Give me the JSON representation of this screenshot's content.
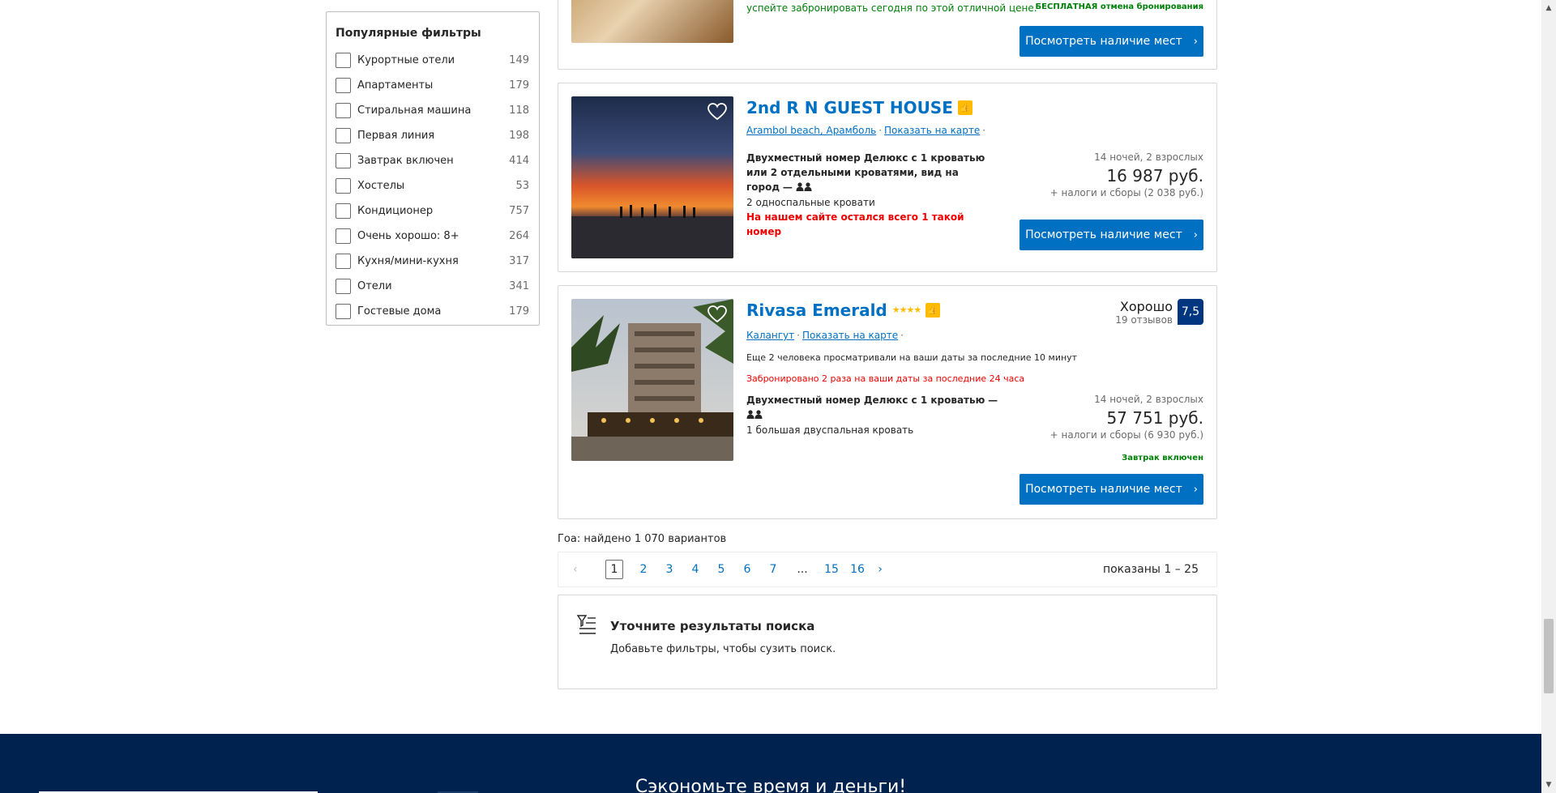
{
  "filters": {
    "title": "Популярные фильтры",
    "items": [
      {
        "label": "Курортные отели",
        "count": "149"
      },
      {
        "label": "Апартаменты",
        "count": "179"
      },
      {
        "label": "Стиральная машина",
        "count": "118"
      },
      {
        "label": "Первая линия",
        "count": "198"
      },
      {
        "label": "Завтрак включен",
        "count": "414"
      },
      {
        "label": "Хостелы",
        "count": "53"
      },
      {
        "label": "Кондиционер",
        "count": "757"
      },
      {
        "label": "Очень хорошо: 8+",
        "count": "264"
      },
      {
        "label": "Кухня/мини-кухня",
        "count": "317"
      },
      {
        "label": "Отели",
        "count": "341"
      },
      {
        "label": "Гостевые дома",
        "count": "179"
      }
    ]
  },
  "cards": {
    "top": {
      "promo": "успейте забронировать сегодня по этой отличной цене.",
      "free_cancel": "БЕСПЛАТНАЯ отмена бронирования",
      "cta": "Посмотреть наличие мест"
    },
    "guesthouse": {
      "name": "2nd R N GUEST HOUSE",
      "location": "Arambol beach, Арамболь",
      "map_link": "Показать на карте",
      "room": "Двухместный номер Делюкс с 1 кроватью или 2 отдельными кроватями, вид на город",
      "dash": "—",
      "beds": "2 односпальные кровати",
      "scarcity": "На нашем сайте остался всего 1 такой номер",
      "nights": "14 ночей, 2 взрослых",
      "price": "16 987 руб.",
      "taxes": "+ налоги и сборы (2 038 руб.)",
      "cta": "Посмотреть наличие мест"
    },
    "rivasa": {
      "name": "Rivasa Emerald",
      "stars": "★★★★",
      "location": "Калангут",
      "map_link": "Показать на карте",
      "viewing": "Еще 2 человека просматривали на ваши даты за последние 10 минут",
      "booked": "Забронировано 2 раза на ваши даты за последние 24 часа",
      "room": "Двухместный номер Делюкс с 1 кроватью",
      "dash": "—",
      "beds": "1 большая двуспальная кровать",
      "rating_word": "Хорошо",
      "reviews": "19 отзывов",
      "score": "7,5",
      "nights": "14 ночей, 2 взрослых",
      "price": "57 751 руб.",
      "taxes": "+ налоги и сборы (6 930 руб.)",
      "breakfast": "Завтрак включен",
      "cta": "Посмотреть наличие мест"
    }
  },
  "results": {
    "count": "Гоа: найдено 1 070 вариантов"
  },
  "pagination": {
    "current": "1",
    "pages": [
      "2",
      "3",
      "4",
      "5",
      "6",
      "7"
    ],
    "dots": "...",
    "last_pages": [
      "15",
      "16"
    ],
    "summary": "показаны 1 – 25"
  },
  "refine": {
    "title": "Уточните результаты поиска",
    "subtitle": "Добавьте фильтры, чтобы сузить поиск."
  },
  "footer": {
    "title": "Сэкономьте время и деньги!"
  },
  "colors": {
    "brand_blue": "#0071c2",
    "navy": "#003580",
    "footer_bg": "#00224f",
    "genius_yellow": "#febb02",
    "red": "#e00000",
    "green": "#008009"
  }
}
